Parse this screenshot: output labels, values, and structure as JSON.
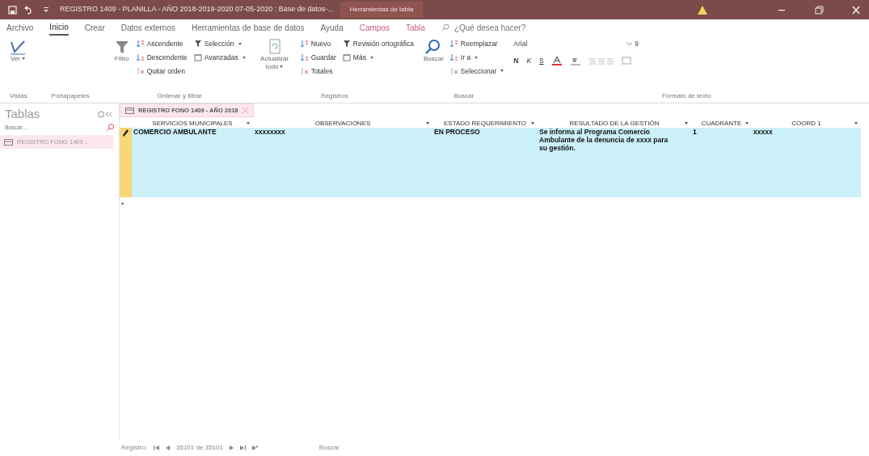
{
  "title_bar": {
    "title": "REGISTRO 1409 - PLANILLA - AÑO 2018-2019-2020 07-05-2020 : Base de datos-...",
    "contextual_label": "Herramientas de tabla"
  },
  "menu_tabs": [
    {
      "label": "Archivo",
      "selected": false,
      "contextual": false
    },
    {
      "label": "Inicio",
      "selected": true,
      "contextual": false
    },
    {
      "label": "Crear",
      "selected": false,
      "contextual": false
    },
    {
      "label": "Datos externos",
      "selected": false,
      "contextual": false
    },
    {
      "label": "Herramientas de base de datos",
      "selected": false,
      "contextual": false
    },
    {
      "label": "Ayuda",
      "selected": false,
      "contextual": false
    },
    {
      "label": "Campos",
      "selected": false,
      "contextual": true
    },
    {
      "label": "Tabla",
      "selected": false,
      "contextual": true
    }
  ],
  "tell_me": {
    "placeholder": "¿Qué desea hacer?"
  },
  "ribbon_groups": [
    {
      "label": "Vistas",
      "items": [
        {
          "label": "Ver",
          "kind": "large",
          "dropdown": true
        }
      ]
    },
    {
      "label": "Portapapeles"
    },
    {
      "label": "Ordenar y filtrar",
      "items": [
        {
          "label": "Filtro",
          "kind": "large",
          "dropdown": false
        },
        {
          "label": "Ascendente",
          "kind": "small",
          "dropdown": false
        },
        {
          "label": "Descendente",
          "kind": "small",
          "dropdown": false
        },
        {
          "label": "Quitar orden",
          "kind": "small",
          "dropdown": false
        },
        {
          "label": "Selección",
          "kind": "small",
          "dropdown": true
        },
        {
          "label": "Avanzadas",
          "kind": "small",
          "dropdown": true
        }
      ]
    },
    {
      "label": "Registros",
      "items": [
        {
          "label": "Actualizar todo",
          "kind": "large",
          "dropdown": true
        },
        {
          "label": "Nuevo",
          "kind": "small",
          "dropdown": false
        },
        {
          "label": "Guardar",
          "kind": "small",
          "dropdown": false
        },
        {
          "label": "Totales",
          "kind": "small",
          "dropdown": false
        },
        {
          "label": "Revisión ortográfica",
          "kind": "small",
          "dropdown": false
        },
        {
          "label": "Más",
          "kind": "small",
          "dropdown": true
        }
      ]
    },
    {
      "label": "Buscar",
      "items": [
        {
          "label": "Buscar",
          "kind": "large",
          "dropdown": false
        },
        {
          "label": "Reemplazar",
          "kind": "small",
          "dropdown": false
        },
        {
          "label": "Ir a",
          "kind": "small",
          "dropdown": true
        },
        {
          "label": "Seleccionar",
          "kind": "small",
          "dropdown": true
        }
      ]
    },
    {
      "label": "Formato de texto",
      "font": "Arial",
      "size": "9",
      "styles": [
        "N",
        "K",
        "S"
      ]
    }
  ],
  "nav_pane": {
    "title": "Tablas",
    "search_placeholder": "Buscar...",
    "items": [
      {
        "label": "REGISTRO FONO 1409 ...",
        "selected": true
      }
    ]
  },
  "document_tab": {
    "label": "REGISTRO FONO 1409 - AÑO 2018",
    "selected": true
  },
  "table": {
    "columns": [
      "SERVICIOS MUNICIPALES",
      "OBSERVACIONES",
      "ESTADO REQUERIMIENTO",
      "RESULTADO DE LA GESTIÓN",
      "CUADRANTE",
      "COORD 1"
    ],
    "rows": [
      {
        "editing": true,
        "cells": [
          "COMERCIO AMBULANTE",
          "xxxxxxxx",
          "EN PROCESO",
          "Se informa al Programa Comercio Ambulante de la denuncia de xxxx para su gestión.",
          "1",
          "xxxxx"
        ]
      }
    ],
    "new_row_marker": "*"
  },
  "status_bar": {
    "label": "Registro:",
    "position": "35101 de 35101",
    "search": "Buscar"
  }
}
